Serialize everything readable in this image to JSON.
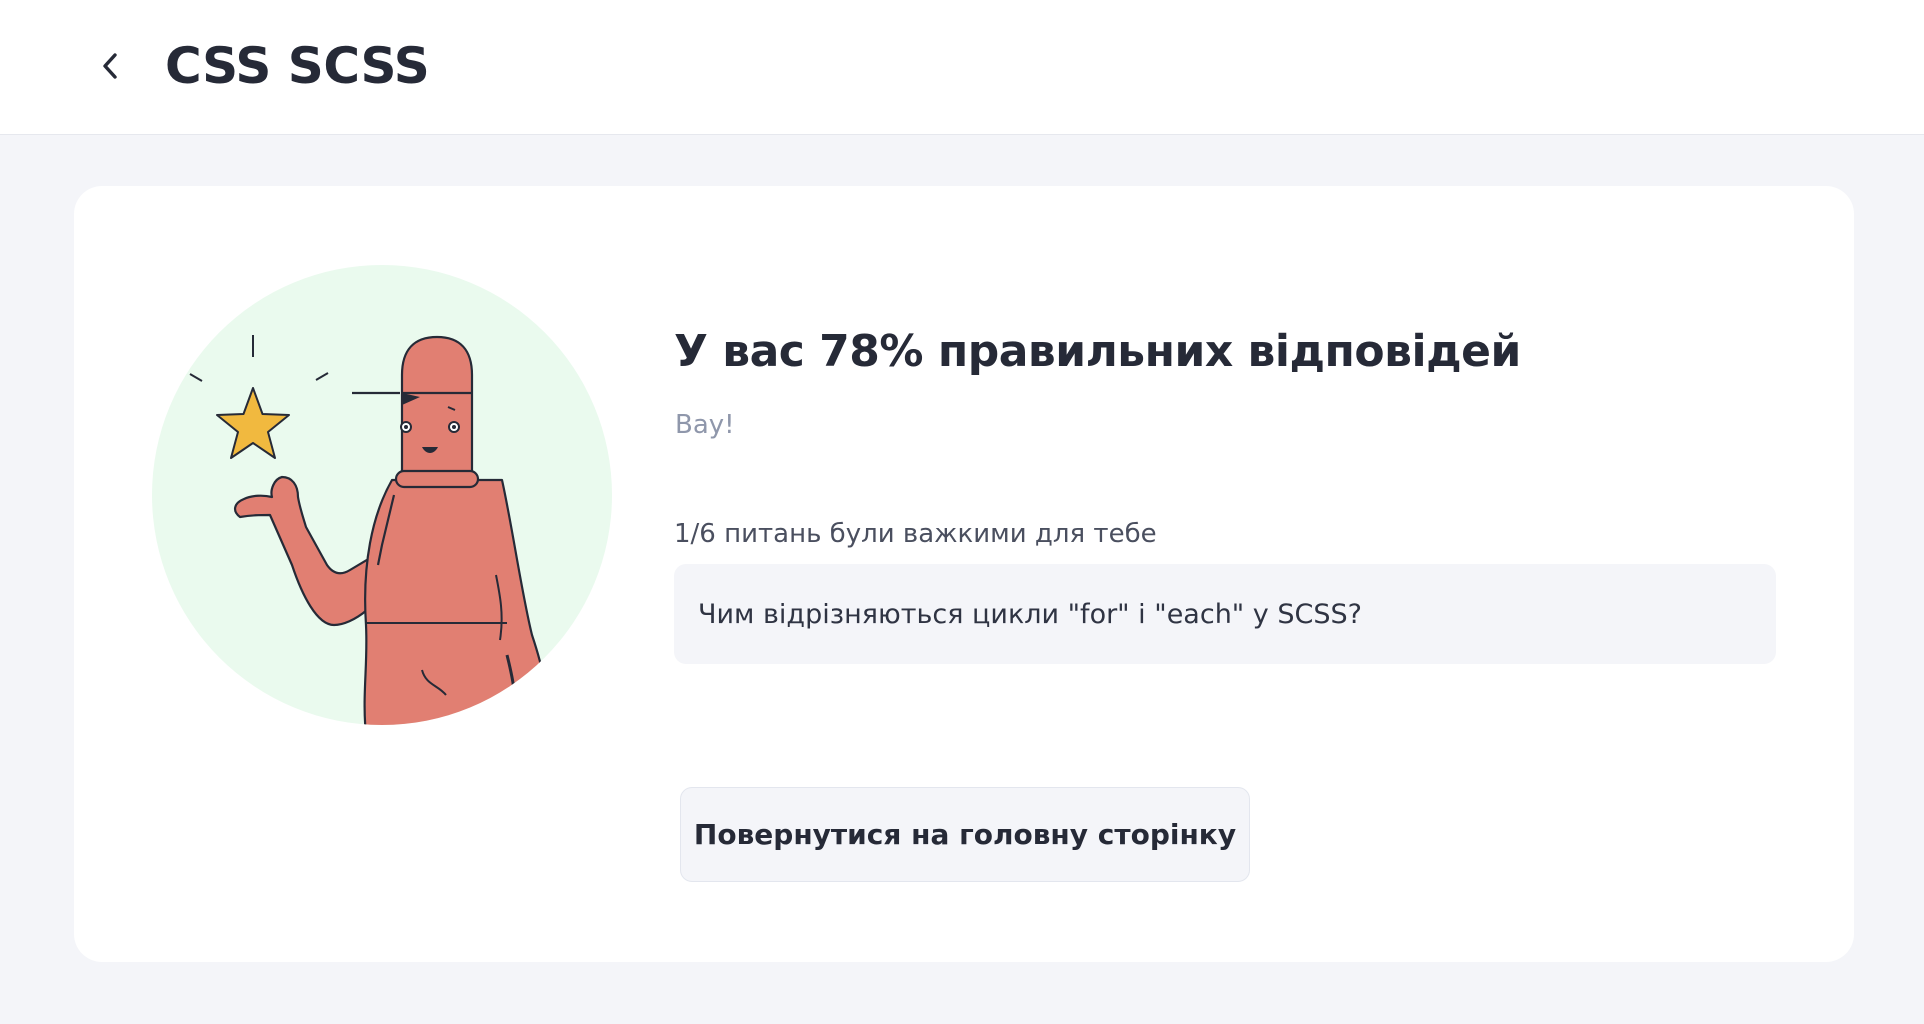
{
  "header": {
    "title": "CSS SCSS",
    "back_icon": "chevron-left-icon"
  },
  "result": {
    "title": "У вас 78% правильних відповідей",
    "subtitle": "Вау!",
    "percent_correct": 78,
    "hard_questions_label": "1/6 питань були важкими для тебе",
    "hard_questions": [
      "Чим відрізняються цикли \"for\" і \"each\" у SCSS?"
    ]
  },
  "actions": {
    "home_label": "Повернутися на головну сторінку"
  },
  "colors": {
    "page_background": "#f4f5f9",
    "card_background": "#ffffff",
    "illustration_circle": "#eafaee",
    "character": "#e17f72",
    "star": "#f1b93f",
    "text_primary": "#262a37",
    "text_muted": "#8f97ab"
  }
}
